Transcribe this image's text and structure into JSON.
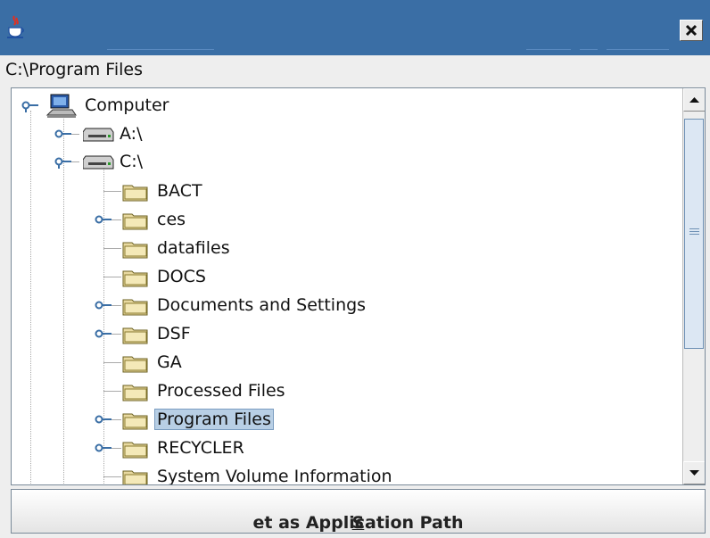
{
  "window": {
    "app_icon": "java-cup-icon",
    "close_icon": "close-icon",
    "title_color": "#3a6ea5"
  },
  "path": {
    "current": "C:\\Program Files"
  },
  "tree": {
    "root": {
      "label": "Computer",
      "icon": "computer-icon"
    },
    "drives": [
      {
        "label": "A:\\",
        "icon": "drive-icon"
      },
      {
        "label": "C:\\",
        "icon": "drive-icon"
      }
    ],
    "folders": [
      {
        "label": "BACT",
        "expandable": false
      },
      {
        "label": "ces",
        "expandable": true
      },
      {
        "label": "datafiles",
        "expandable": false
      },
      {
        "label": "DOCS",
        "expandable": false
      },
      {
        "label": "Documents and Settings",
        "expandable": true
      },
      {
        "label": "DSF",
        "expandable": true
      },
      {
        "label": "GA",
        "expandable": false
      },
      {
        "label": "Processed Files",
        "expandable": false
      },
      {
        "label": "Program Files",
        "expandable": true,
        "selected": true
      },
      {
        "label": "RECYCLER",
        "expandable": true
      },
      {
        "label": "System Volume Information",
        "expandable": false
      }
    ]
  },
  "action": {
    "mnemonic": "S",
    "rest": "et as Application Path"
  }
}
